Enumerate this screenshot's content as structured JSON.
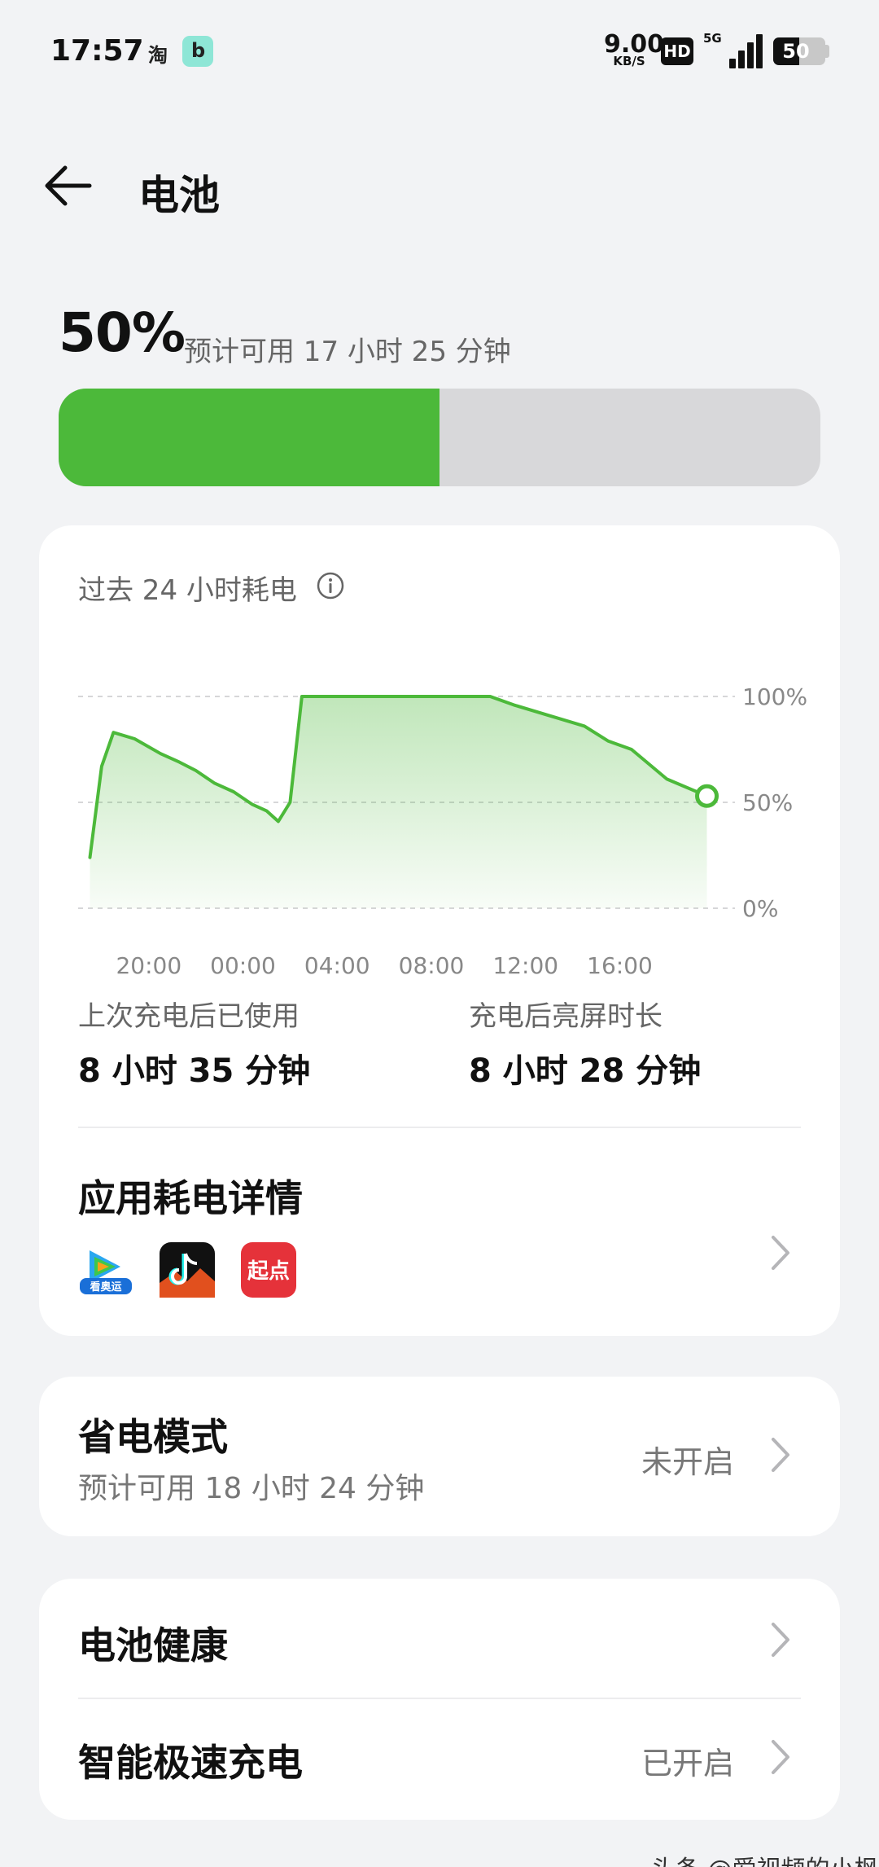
{
  "status_bar": {
    "time": "17:57",
    "app_icon_1": "淘",
    "app_icon_2": "b",
    "net_speed": "9.00",
    "net_speed_unit": "KB/S",
    "hd_badge": "HD",
    "network_type": "5G",
    "signal_level": 4,
    "battery_level": "50",
    "battery_fraction": 0.5
  },
  "header": {
    "back_icon": "arrow-left-icon",
    "title": "电池"
  },
  "battery": {
    "percent": "50%",
    "estimate": "预计可用 17 小时 25 分钟",
    "level_fraction": 0.5,
    "bar_color": "#4cb93a"
  },
  "usage_card": {
    "title": "过去 24 小时耗电",
    "info_icon": "info-circle-icon",
    "stats": [
      {
        "label": "上次充电后已使用",
        "value": "8 小时 35 分钟"
      },
      {
        "label": "充电后亮屏时长",
        "value": "8 小时 28 分钟"
      }
    ],
    "app_usage": {
      "title": "应用耗电详情",
      "apps": [
        {
          "name": "看奥运",
          "icon": "tencent-video-icon"
        },
        {
          "name": "抖音",
          "icon": "tiktok-icon"
        },
        {
          "name": "起点",
          "icon": "qidian-icon"
        }
      ]
    }
  },
  "chart_data": {
    "type": "area",
    "title": "过去 24 小时耗电",
    "x_tick_labels": [
      "20:00",
      "00:00",
      "04:00",
      "08:00",
      "12:00",
      "16:00"
    ],
    "y_tick_labels": [
      "100%",
      "50%",
      "0%"
    ],
    "ylim": [
      0,
      100
    ],
    "grid": true,
    "series": [
      {
        "x": [
          17.5,
          18.0,
          18.5,
          19.4,
          20.5,
          21.3,
          22.0,
          22.8,
          23.6,
          24.4,
          25.0,
          25.5,
          26.0,
          26.5,
          27.0,
          30.0,
          33.0,
          34.5,
          35.5,
          37.0,
          38.5,
          39.5,
          40.5,
          42.0,
          43.7
        ],
        "y": [
          24,
          67,
          83,
          80,
          73,
          69,
          65,
          59,
          55,
          49,
          46,
          41,
          50,
          100,
          100,
          100,
          100,
          100,
          96,
          91,
          86,
          79,
          75,
          61,
          53
        ],
        "color": "#4cb93a"
      }
    ]
  },
  "power_save": {
    "title": "省电模式",
    "subtitle": "预计可用 18 小时 24 分钟",
    "status": "未开启"
  },
  "health_card": {
    "items": [
      {
        "title": "电池健康",
        "status": ""
      },
      {
        "title": "智能极速充电",
        "status": "已开启"
      }
    ]
  },
  "watermark": "头条 @爱视频的小枫"
}
